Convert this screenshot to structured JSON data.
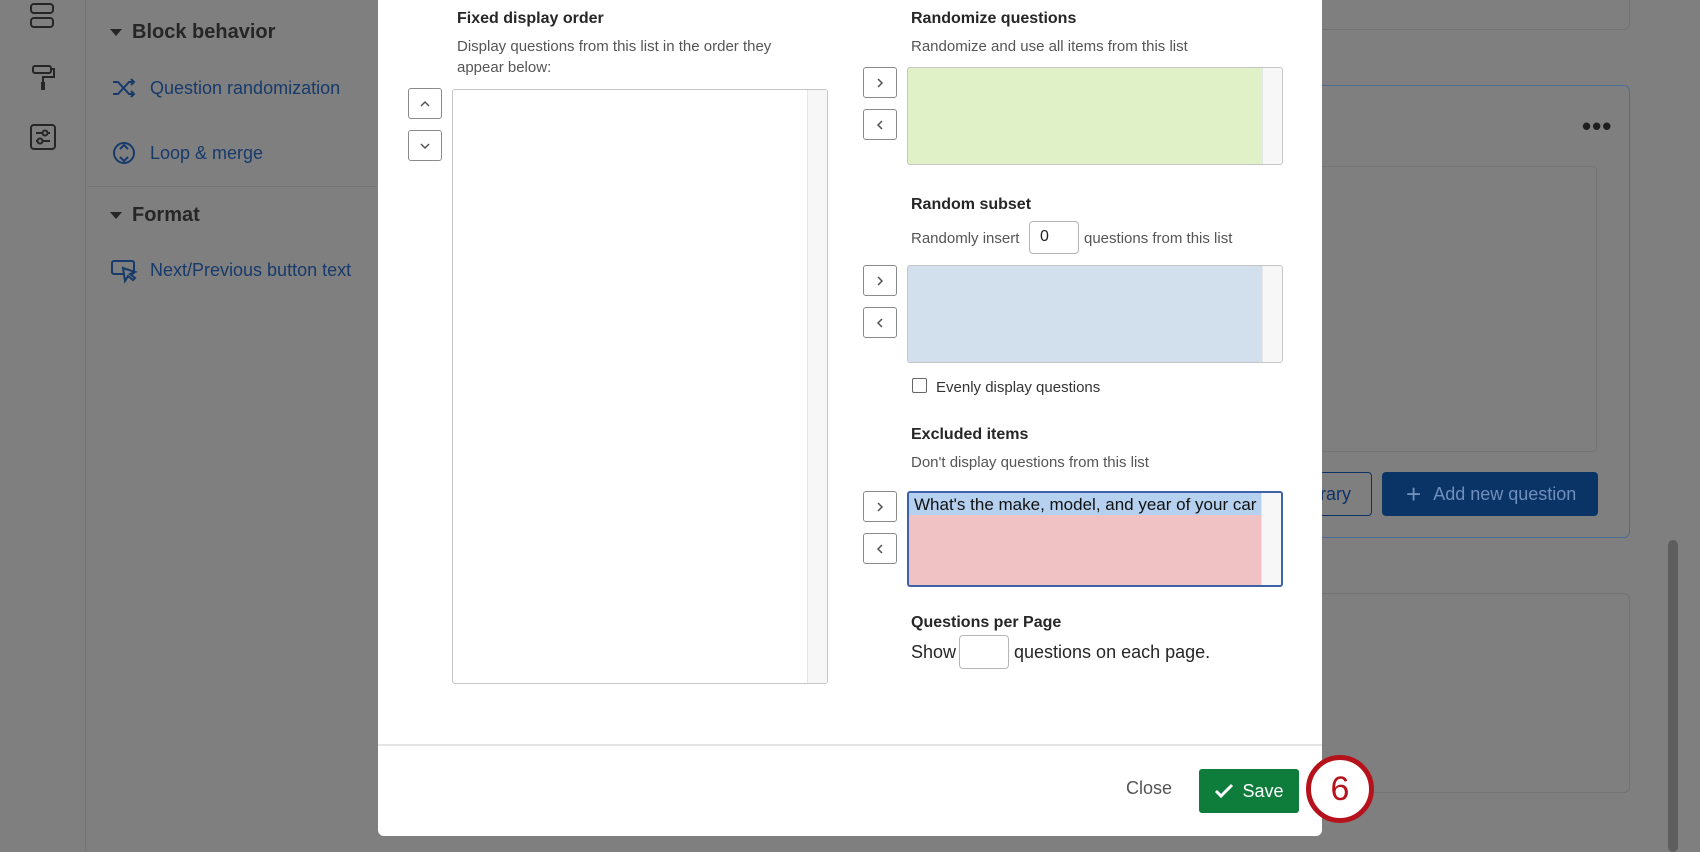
{
  "background": {
    "sidebar_sections": [
      {
        "title": "Block behavior",
        "links": [
          "Question randomization",
          "Loop & merge"
        ]
      },
      {
        "title": "Format",
        "links": [
          "Next/Previous button text"
        ]
      }
    ],
    "library_button_label": "rary",
    "add_question_label": "Add new question"
  },
  "modal": {
    "fixed_order": {
      "title": "Fixed display order",
      "description": "Display questions from this list in the order they appear below:"
    },
    "randomize": {
      "title": "Randomize questions",
      "description": "Randomize and use all items from this list"
    },
    "subset": {
      "title": "Random subset",
      "prefix": "Randomly insert",
      "count": "0",
      "suffix": "questions from this list",
      "evenly_label": "Evenly display questions"
    },
    "excluded": {
      "title": "Excluded items",
      "description": "Don't display questions from this list",
      "items": [
        "What's the make, model, and year of your car"
      ]
    },
    "per_page": {
      "title": "Questions per Page",
      "prefix": "Show",
      "value": "",
      "suffix": "questions on each page."
    },
    "footer": {
      "close_label": "Close",
      "save_label": "Save",
      "step_number": "6"
    }
  },
  "colors": {
    "randomize_box": "#e0f0c7",
    "subset_box": "#d2e0ee",
    "excluded_box": "#f0c2c4",
    "save_green": "#0e7c3a",
    "badge_red": "#b5121b"
  }
}
